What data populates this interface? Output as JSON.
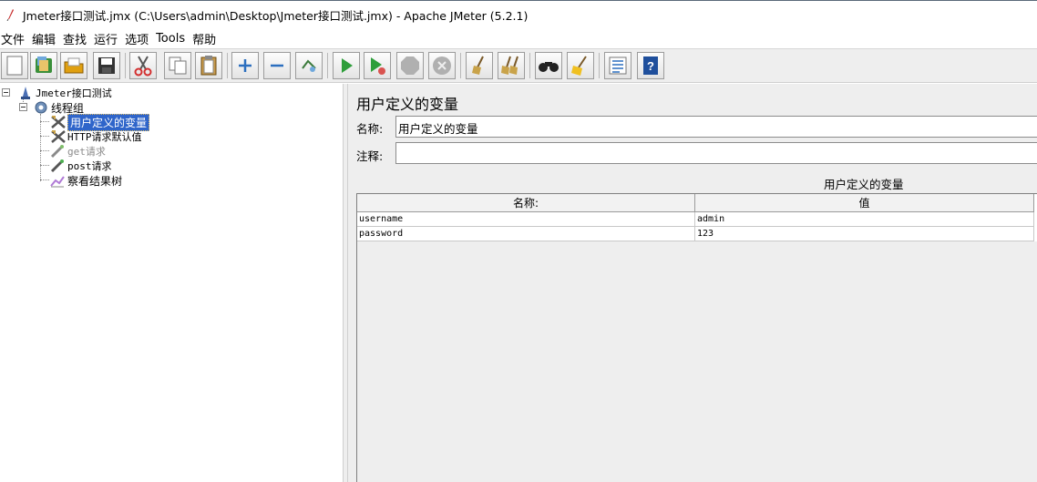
{
  "window": {
    "title": "Jmeter接口测试.jmx (C:\\Users\\admin\\Desktop\\Jmeter接口测试.jmx) - Apache JMeter (5.2.1)"
  },
  "menu": [
    "文件",
    "编辑",
    "查找",
    "运行",
    "选项",
    "Tools",
    "帮助"
  ],
  "toolbar": {
    "buttons": [
      {
        "name": "new-icon"
      },
      {
        "name": "templates-icon"
      },
      {
        "name": "open-icon"
      },
      {
        "name": "save-icon"
      },
      {
        "name": "cut-icon"
      },
      {
        "name": "copy-icon"
      },
      {
        "name": "paste-icon"
      },
      {
        "name": "expand-icon"
      },
      {
        "name": "collapse-icon"
      },
      {
        "name": "toggle-icon"
      },
      {
        "name": "start-icon"
      },
      {
        "name": "start-no-pause-icon"
      },
      {
        "name": "stop-icon"
      },
      {
        "name": "shutdown-icon"
      },
      {
        "name": "clear-icon"
      },
      {
        "name": "clear-all-icon"
      },
      {
        "name": "search-icon"
      },
      {
        "name": "reset-search-icon"
      },
      {
        "name": "function-helper-icon"
      },
      {
        "name": "help-icon"
      }
    ]
  },
  "tree": {
    "root": "Jmeter接口测试",
    "thread_group": "线程组",
    "children": [
      {
        "label": "用户定义的变量",
        "selected": true,
        "disabled": false
      },
      {
        "label": "HTTP请求默认值",
        "selected": false,
        "disabled": false
      },
      {
        "label": "get请求",
        "selected": false,
        "disabled": true
      },
      {
        "label": "post请求",
        "selected": false,
        "disabled": false
      },
      {
        "label": "察看结果树",
        "selected": false,
        "disabled": false
      }
    ]
  },
  "panel": {
    "title": "用户定义的变量",
    "name_label": "名称:",
    "name_value": "用户定义的变量",
    "comment_label": "注释:",
    "comment_value": "",
    "section_title": "用户定义的变量",
    "table": {
      "headers": [
        "名称:",
        "值"
      ],
      "rows": [
        [
          "username",
          "admin"
        ],
        [
          "password",
          "123"
        ]
      ]
    }
  }
}
